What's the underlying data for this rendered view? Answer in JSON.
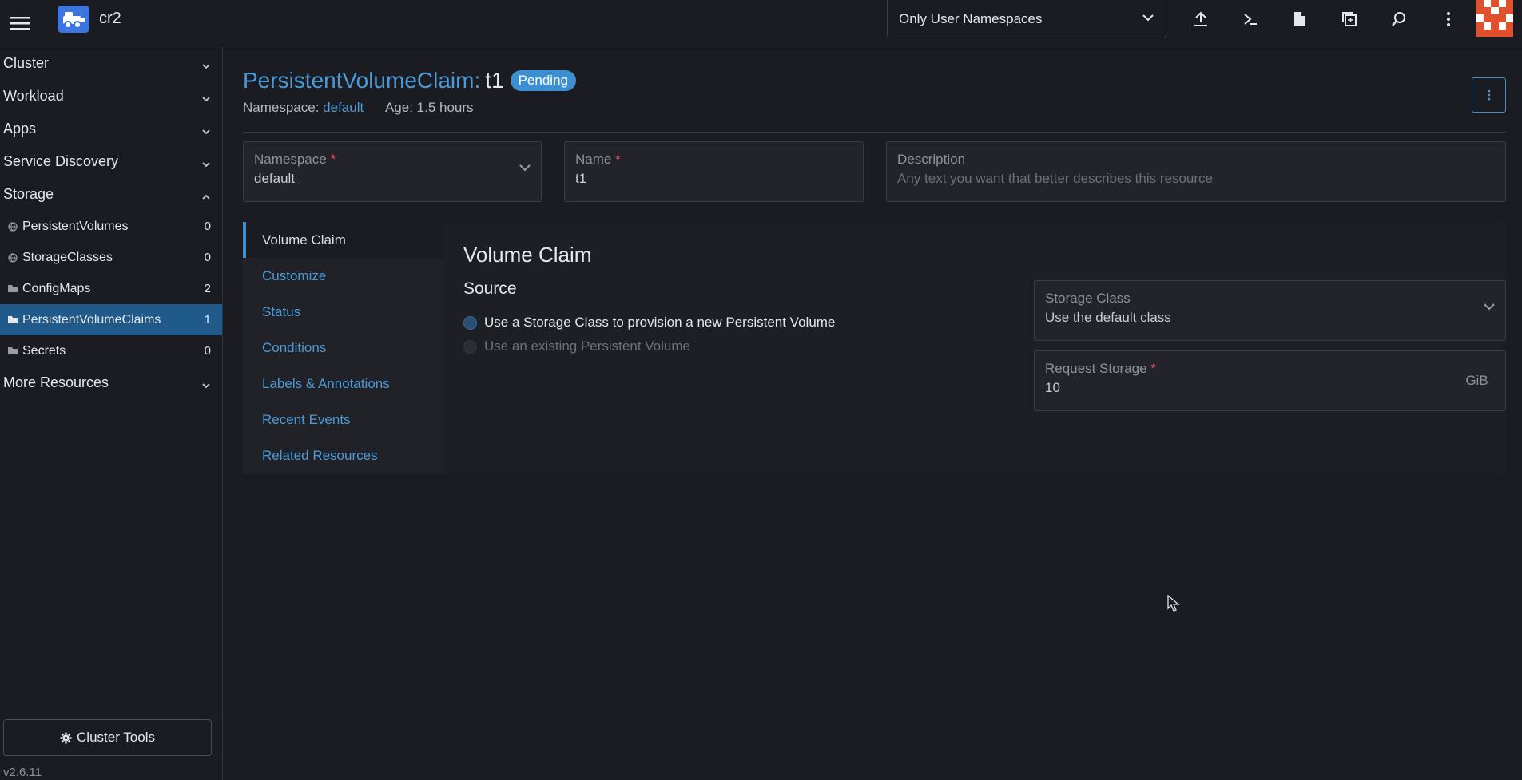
{
  "header": {
    "cluster_name": "cr2",
    "namespace_filter": "Only User Namespaces",
    "icons": [
      "hamburger-icon",
      "rancher-logo-icon",
      "upload-icon",
      "shell-icon",
      "file-icon",
      "copy-config-icon",
      "search-icon",
      "more-vertical-icon"
    ]
  },
  "sidebar": {
    "groups": {
      "cluster": "Cluster",
      "workload": "Workload",
      "apps": "Apps",
      "service_discovery": "Service Discovery",
      "storage": "Storage",
      "more_resources": "More Resources"
    },
    "items": [
      {
        "label": "PersistentVolumes",
        "count": "0",
        "icon": "globe-icon"
      },
      {
        "label": "StorageClasses",
        "count": "0",
        "icon": "globe-icon"
      },
      {
        "label": "ConfigMaps",
        "count": "2",
        "icon": "folder-icon"
      },
      {
        "label": "PersistentVolumeClaims",
        "count": "1",
        "icon": "folder-icon",
        "active": true
      },
      {
        "label": "Secrets",
        "count": "0",
        "icon": "folder-icon"
      }
    ],
    "cluster_tools": "Cluster Tools",
    "version": "v2.6.11"
  },
  "page": {
    "type_label": "PersistentVolumeClaim:",
    "name": "t1",
    "status": "Pending",
    "namespace_label": "Namespace:",
    "namespace_value": "default",
    "age": "Age: 1.5 hours"
  },
  "form": {
    "namespace_label": "Namespace",
    "namespace_value": "default",
    "name_label": "Name",
    "name_value": "t1",
    "description_label": "Description",
    "description_placeholder": "Any text you want that better describes this resource",
    "required_mark": "*"
  },
  "tabs": [
    "Volume Claim",
    "Customize",
    "Status",
    "Conditions",
    "Labels & Annotations",
    "Recent Events",
    "Related Resources"
  ],
  "volume_claim": {
    "title": "Volume Claim",
    "source_title": "Source",
    "option_new": "Use a Storage Class to provision a new Persistent Volume",
    "option_existing": "Use an existing Persistent Volume",
    "storage_class_label": "Storage Class",
    "storage_class_value": "Use the default class",
    "request_storage_label": "Request Storage",
    "request_storage_value": "10",
    "request_storage_unit": "GiB"
  },
  "colors": {
    "accent": "#3d8fd1",
    "link": "#4a9ad8",
    "background": "#1b1c21",
    "active_nav": "#1f5a8a",
    "required": "#e0555c"
  }
}
